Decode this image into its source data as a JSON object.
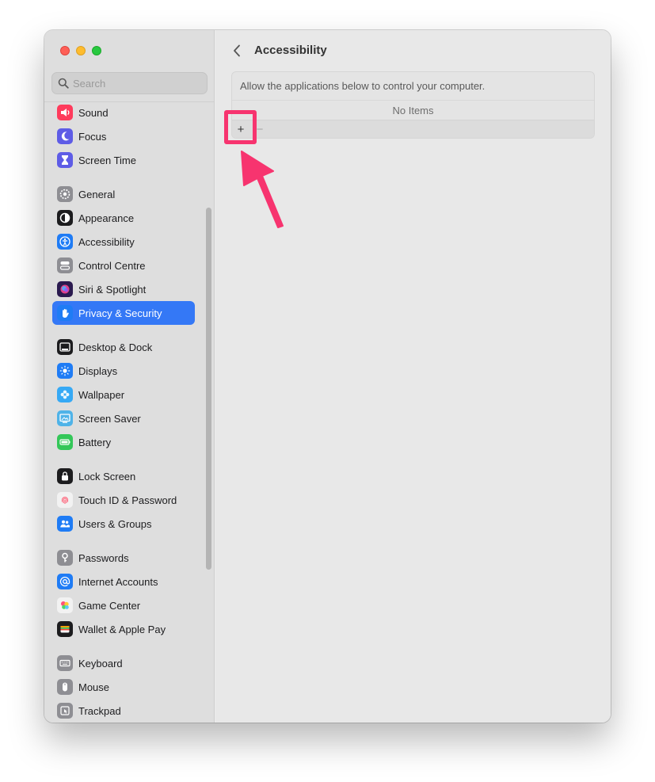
{
  "colors": {
    "accent": "#3478f6",
    "highlight": "#f7346f"
  },
  "search": {
    "placeholder": "Search"
  },
  "sidebar": {
    "groups": [
      [
        {
          "label": "Sound",
          "icon": "speaker-icon",
          "color": "#ff3b5c"
        },
        {
          "label": "Focus",
          "icon": "moon-icon",
          "color": "#5e5ce6"
        },
        {
          "label": "Screen Time",
          "icon": "hourglass-icon",
          "color": "#5e5ce6"
        }
      ],
      [
        {
          "label": "General",
          "icon": "gear-icon",
          "color": "#8e8e93"
        },
        {
          "label": "Appearance",
          "icon": "appearance-icon",
          "color": "#1c1c1e"
        },
        {
          "label": "Accessibility",
          "icon": "accessibility-icon",
          "color": "#1f7cf5"
        },
        {
          "label": "Control Centre",
          "icon": "toggles-icon",
          "color": "#8e8e93"
        },
        {
          "label": "Siri & Spotlight",
          "icon": "siri-icon",
          "color": "#2b1a4f"
        },
        {
          "label": "Privacy & Security",
          "icon": "hand-icon",
          "color": "#1f7cf5",
          "selected": true
        }
      ],
      [
        {
          "label": "Desktop & Dock",
          "icon": "dock-icon",
          "color": "#1c1c1e"
        },
        {
          "label": "Displays",
          "icon": "sun-icon",
          "color": "#1f7cf5"
        },
        {
          "label": "Wallpaper",
          "icon": "flower-icon",
          "color": "#36a9f5"
        },
        {
          "label": "Screen Saver",
          "icon": "screensaver-icon",
          "color": "#4fb3e8"
        },
        {
          "label": "Battery",
          "icon": "battery-icon",
          "color": "#34c759"
        }
      ],
      [
        {
          "label": "Lock Screen",
          "icon": "lock-icon",
          "color": "#1c1c1e"
        },
        {
          "label": "Touch ID & Password",
          "icon": "fingerprint-icon",
          "color": "#f2f2f2"
        },
        {
          "label": "Users & Groups",
          "icon": "users-icon",
          "color": "#1f7cf5"
        }
      ],
      [
        {
          "label": "Passwords",
          "icon": "key-icon",
          "color": "#8e8e93"
        },
        {
          "label": "Internet Accounts",
          "icon": "at-icon",
          "color": "#1f7cf5"
        },
        {
          "label": "Game Center",
          "icon": "game-center-icon",
          "color": "#f2f2f2"
        },
        {
          "label": "Wallet & Apple Pay",
          "icon": "wallet-icon",
          "color": "#1c1c1e"
        }
      ],
      [
        {
          "label": "Keyboard",
          "icon": "keyboard-icon",
          "color": "#8e8e93"
        },
        {
          "label": "Mouse",
          "icon": "mouse-icon",
          "color": "#8e8e93"
        },
        {
          "label": "Trackpad",
          "icon": "trackpad-icon",
          "color": "#8e8e93"
        }
      ]
    ]
  },
  "main": {
    "title": "Accessibility",
    "description": "Allow the applications below to control your computer.",
    "empty_text": "No Items",
    "add_label": "+",
    "remove_label": "−"
  }
}
